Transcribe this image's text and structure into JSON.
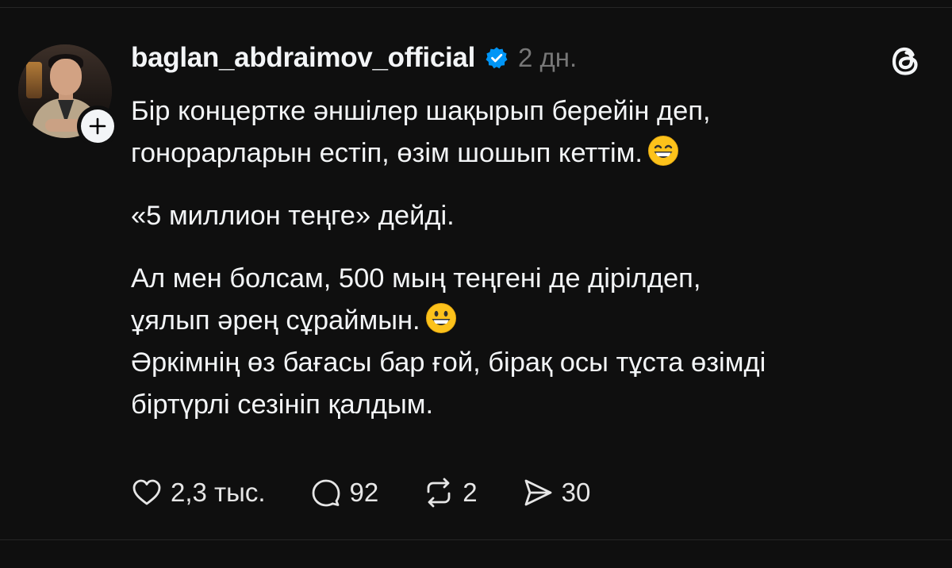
{
  "post": {
    "username": "baglan_abdraimov_official",
    "time": "2 дн.",
    "lines_1": [
      "Бір концертке әншілер шақырып берейін деп,",
      "гонорарларын естіп, өзім шошып кеттім."
    ],
    "line_2": "«5 миллион теңге» дейді.",
    "lines_3": [
      "Ал мен болсам, 500 мың теңгені де дірілдеп,",
      "ұялып әрең сұраймын."
    ],
    "lines_4": [
      "Әркімнің өз бағасы бар ғой, бірақ осы тұста өзімді",
      "біртүрлі сезініп қалдым."
    ]
  },
  "actions": {
    "likes": "2,3 тыс.",
    "comments": "92",
    "reposts": "2",
    "shares": "30"
  },
  "icons": {
    "verified": "verified-badge-icon",
    "threads": "threads-logo-icon",
    "follow": "plus-icon",
    "like": "heart-icon",
    "comment": "comment-bubble-icon",
    "repost": "repost-icon",
    "share": "share-send-icon",
    "emoji_1": "grinning-smiling-eyes-emoji",
    "emoji_2": "grinning-face-emoji"
  },
  "colors": {
    "background": "#0f0f0f",
    "text": "#f3f5f7",
    "muted": "#777777",
    "verified": "#0095f6"
  }
}
